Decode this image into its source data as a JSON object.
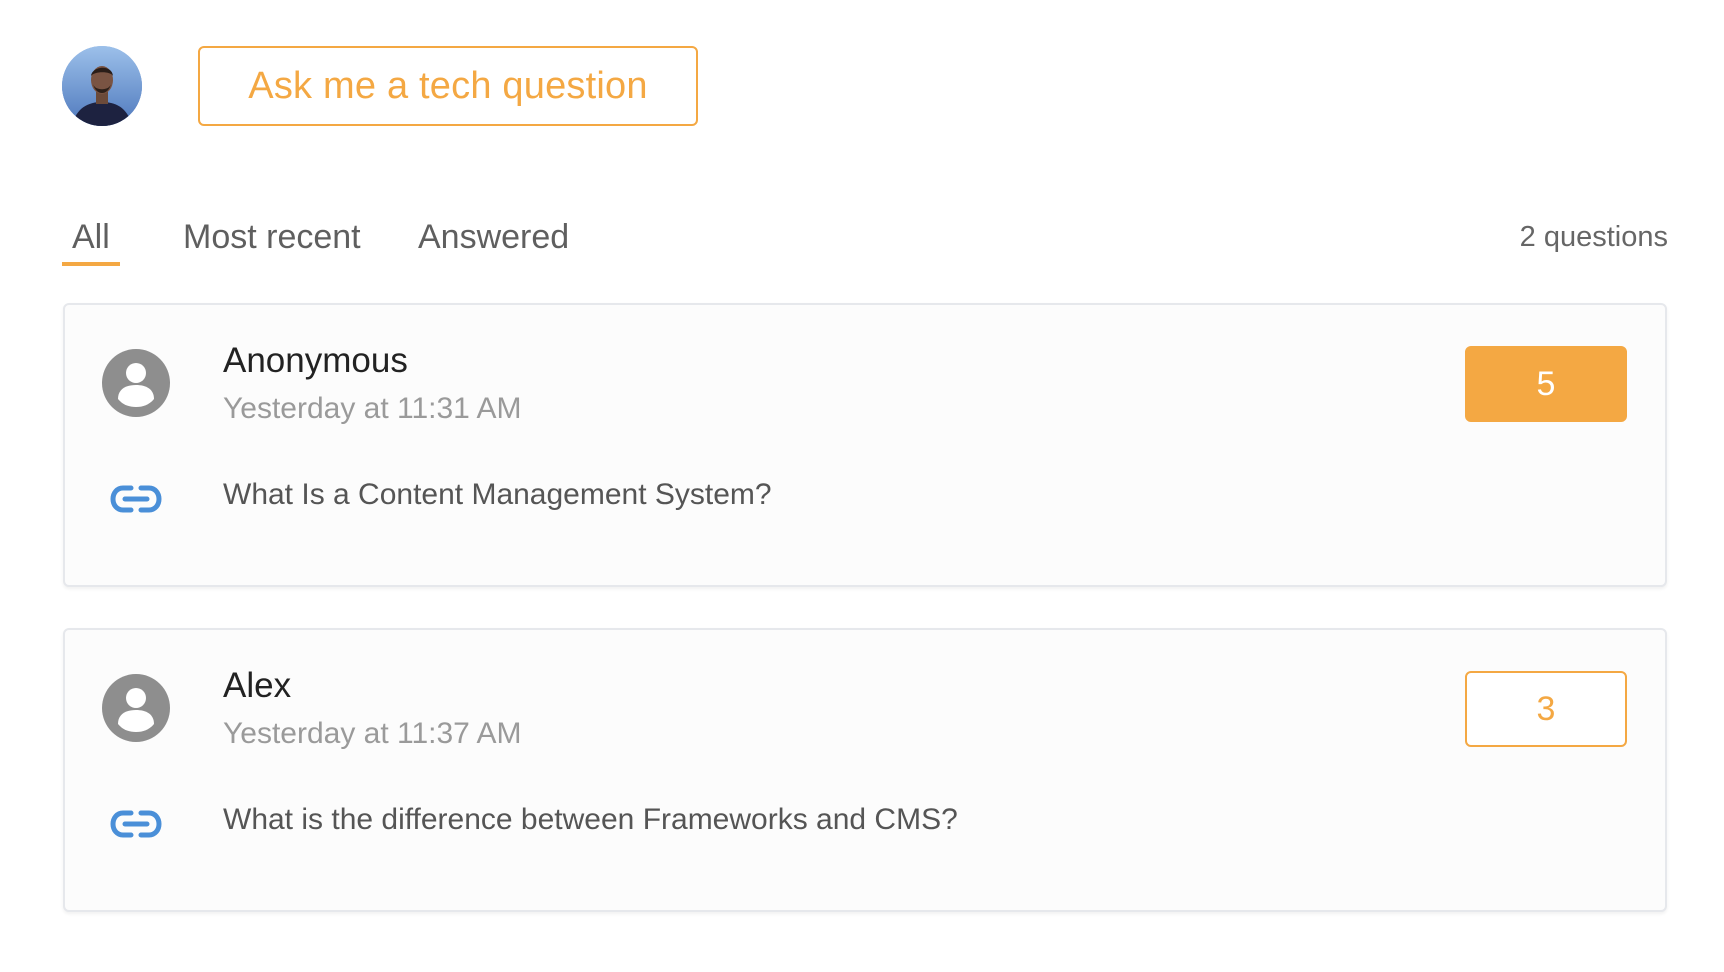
{
  "header": {
    "avatar_icon": "profile-photo",
    "ask_button_label": "Ask me a tech question"
  },
  "tabs": [
    {
      "label": "All",
      "active": true
    },
    {
      "label": "Most recent",
      "active": false
    },
    {
      "label": "Answered",
      "active": false
    }
  ],
  "question_count": "2 questions",
  "questions": [
    {
      "author": "Anonymous",
      "time": "Yesterday at 11:31 AM",
      "text": "What Is a Content Management System?",
      "votes": "5",
      "voted": true,
      "author_icon": "user-circle-icon",
      "link_icon": "link-icon"
    },
    {
      "author": "Alex",
      "time": "Yesterday at 11:37 AM",
      "text": "What is the difference between Frameworks and CMS?",
      "votes": "3",
      "voted": false,
      "author_icon": "user-circle-icon",
      "link_icon": "link-icon"
    }
  ],
  "colors": {
    "accent": "#f4a843",
    "link_icon": "#4a8fd8",
    "user_icon": "#8e8e8e"
  }
}
